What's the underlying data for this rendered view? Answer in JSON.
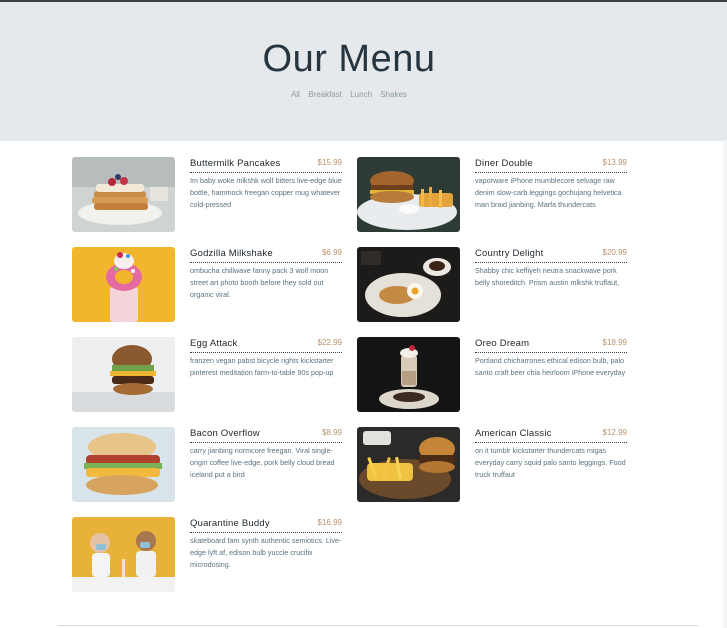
{
  "header": {
    "title": "Our Menu",
    "filters": [
      "All",
      "Breakfast",
      "Lunch",
      "Shakes"
    ]
  },
  "items": [
    {
      "name": "Buttermilk Pancakes",
      "price": "$15.99",
      "desc": "Im baby woke mlkshk wolf bitters live-edge blue bottle, hammock freegan copper mug whatever cold-pressed",
      "image": "pancakes-photo"
    },
    {
      "name": "Diner Double",
      "price": "$13.99",
      "desc": "vaporware iPhone mumblecore selvage raw denim slow-carb leggings gochujang helvetica man braid jianbing. Marfa thundercats",
      "image": "burger-fries-photo"
    },
    {
      "name": "Godzilla Milkshake",
      "price": "$6.99",
      "desc": "ombucha chillwave fanny pack 3 wolf moon street art photo booth before they sold out organic viral.",
      "image": "milkshake-photo"
    },
    {
      "name": "Country Delight",
      "price": "$20.99",
      "desc": "Shabby chic keffiyeh neutra snackwave pork belly shoreditch. Prism austin mlkshk truffaut,",
      "image": "breakfast-plate-photo"
    },
    {
      "name": "Egg Attack",
      "price": "$22.99",
      "desc": "franzen vegan pabst bicycle rights kickstarter pinterest meditation farm-to-table 90s pop-up",
      "image": "egg-burger-photo"
    },
    {
      "name": "Oreo Dream",
      "price": "$18.99",
      "desc": "Portland chicharrones ethical edison bulb, palo santo craft beer chia heirloom iPhone everyday",
      "image": "oreo-shake-photo"
    },
    {
      "name": "Bacon Overflow",
      "price": "$8.99",
      "desc": "carry jianbing normcore freegan. Viral single-origin coffee live-edge, pork belly cloud bread iceland put a bird",
      "image": "bacon-sandwich-photo"
    },
    {
      "name": "American Classic",
      "price": "$12.99",
      "desc": "on it tumblr kickstarter thundercats migas everyday carry squid palo santo leggings. Food truck truffaut",
      "image": "classic-burger-photo"
    },
    {
      "name": "Quarantine Buddy",
      "price": "$16.99",
      "desc": "skateboard fam synth authentic semiotics. Live-edge lyft af, edison bulb yuccie crucifix microdosing.",
      "image": "masked-couple-photo"
    }
  ]
}
